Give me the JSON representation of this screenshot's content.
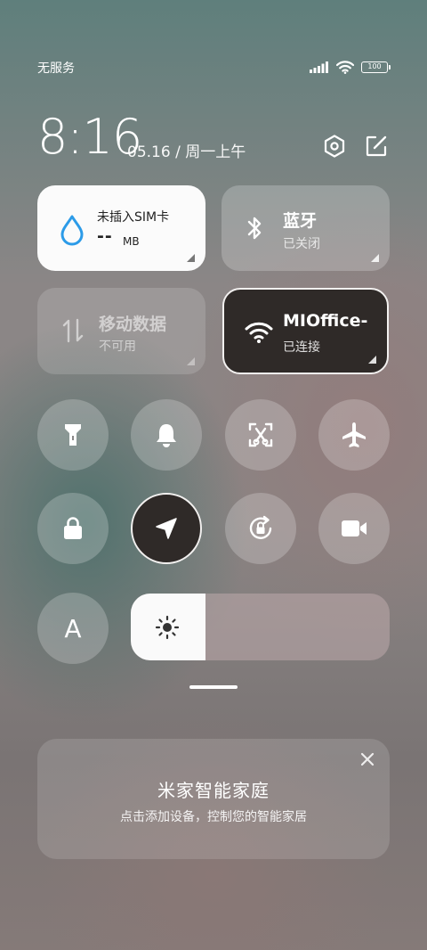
{
  "status_bar": {
    "carrier": "无服务",
    "battery": "100",
    "icons": [
      "signal-icon",
      "wifi-icon",
      "battery-icon"
    ]
  },
  "header": {
    "time": "8:16",
    "date": "05.16 / 周一上午",
    "icons": [
      "settings-icon",
      "edit-icon"
    ]
  },
  "tiles": {
    "sim": {
      "title": "未插入SIM卡",
      "value": "--",
      "unit": "MB",
      "icon": "water-drop-icon"
    },
    "bluetooth": {
      "title": "蓝牙",
      "status": "已关闭",
      "icon": "bluetooth-icon"
    },
    "mobile_data": {
      "title": "移动数据",
      "status": "不可用",
      "icon": "data-arrows-icon"
    },
    "wifi": {
      "title": "MIOffice-",
      "status": "已连接",
      "icon": "wifi-icon"
    }
  },
  "toggles_row1": [
    "flashlight-icon",
    "bell-icon",
    "screenshot-icon",
    "airplane-icon"
  ],
  "toggles_row2": [
    "lock-icon",
    "location-icon",
    "rotation-lock-icon",
    "video-camera-icon"
  ],
  "auto_brightness_label": "A",
  "brightness": {
    "level": 0.29,
    "icon": "sun-icon"
  },
  "mijia_card": {
    "title": "米家智能家庭",
    "subtitle": "点击添加设备，控制您的智能家居",
    "close_icon": "close-icon"
  },
  "colors": {
    "tile_active_light": "#fbfbfb",
    "tile_active_dark": "#2f2a28",
    "sim_icon": "#2c9be8"
  }
}
